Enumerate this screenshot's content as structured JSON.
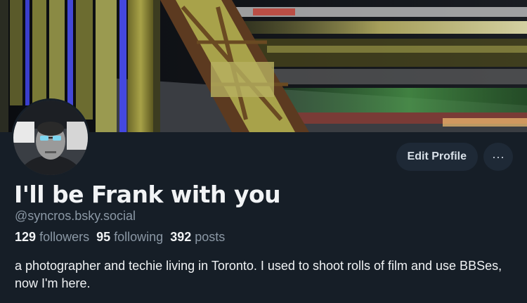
{
  "profile": {
    "display_name": "I'll be Frank with you",
    "handle": "@syncros.bsky.social",
    "bio": "a photographer and techie living in Toronto. I used to shoot rolls of film and use BBSes, now I'm here.",
    "stats": {
      "followers_count": "129",
      "followers_label": "followers",
      "following_count": "95",
      "following_label": "following",
      "posts_count": "392",
      "posts_label": "posts"
    }
  },
  "actions": {
    "edit_label": "Edit Profile",
    "more_icon": "more-horizontal-icon",
    "more_glyph": "···"
  },
  "colors": {
    "background": "#161e27",
    "button_bg": "#1e2936",
    "muted_text": "#8b98a5",
    "primary_text": "#f1f3f5"
  }
}
